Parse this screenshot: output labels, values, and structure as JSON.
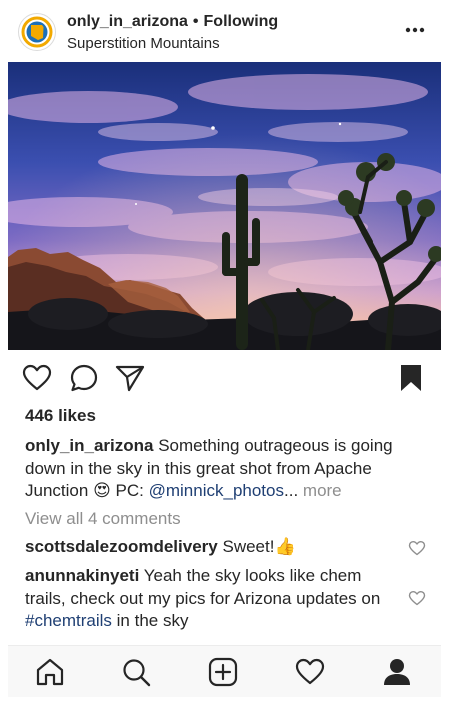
{
  "post": {
    "username": "only_in_arizona",
    "separator": "•",
    "follow_status": "Following",
    "location": "Superstition Mountains"
  },
  "likes": "446 likes",
  "caption": {
    "user": "only_in_arizona",
    "text": "Something outrageous is going down in the sky in this great shot from Apache Junction",
    "emoji": "😍",
    "pc_label": "PC:",
    "mention": "@minnick_photos",
    "ellipsis": "...",
    "more": "more"
  },
  "view_all_comments": "View all 4 comments",
  "comments": [
    {
      "user": "scottsdalezoomdelivery",
      "text": "Sweet!",
      "emoji": "👍"
    },
    {
      "user": "anunnakinyeti",
      "text_before": "Yeah the sky looks like chem trails, check out my pics for Arizona updates on",
      "hashtag": "#chemtrails",
      "text_after": "in the sky"
    }
  ],
  "icons": {
    "header": [
      "profile-avatar",
      "more-options-icon"
    ],
    "actions": [
      "heart-icon",
      "comment-icon",
      "share-icon",
      "bookmark-icon"
    ],
    "tabbar": [
      "home-icon",
      "search-icon",
      "add-post-icon",
      "activity-heart-icon",
      "profile-icon"
    ]
  },
  "colors": {
    "text": "#262626",
    "muted": "#8e8e8e",
    "link": "#1f3f73",
    "avatar_accent": "#f2a900",
    "tabbar_bg": "#f8f8f8"
  }
}
